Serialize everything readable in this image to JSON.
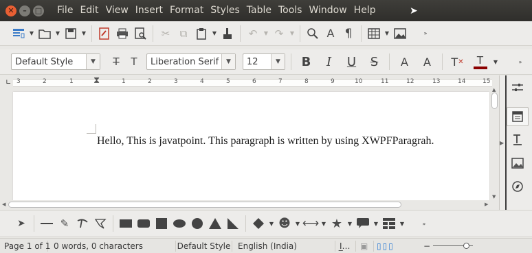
{
  "menubar": {
    "window_buttons": {
      "close": "✕",
      "minimize": "–",
      "maximize": "□"
    },
    "items": [
      "File",
      "Edit",
      "View",
      "Insert",
      "Format",
      "Styles",
      "Table",
      "Tools",
      "Window",
      "Help"
    ]
  },
  "standard_toolbar": {
    "icons": [
      "new-document-icon",
      "open-icon",
      "save-icon",
      "export-pdf-icon",
      "print-icon",
      "print-preview-icon",
      "cut-icon",
      "copy-icon",
      "paste-icon",
      "clone-formatting-icon",
      "undo-icon",
      "redo-icon",
      "find-replace-icon",
      "spelling-icon",
      "formatting-marks-icon",
      "insert-table-icon",
      "insert-image-icon"
    ]
  },
  "formatting_toolbar": {
    "paragraph_style": "Default Style",
    "font_name": "Liberation Serif",
    "font_size": "12",
    "bold": "B",
    "italic": "I",
    "underline": "U",
    "strikethrough": "S",
    "superscript": "A",
    "subscript": "A",
    "font_color": "#8b0000"
  },
  "ruler": {
    "left_numbers": [
      "3",
      "2",
      "1"
    ],
    "right_numbers": [
      "1",
      "2",
      "3",
      "4",
      "5",
      "6",
      "7",
      "8",
      "9",
      "10",
      "11",
      "12",
      "13",
      "14",
      "15"
    ]
  },
  "document": {
    "text": "Hello, This is javatpoint. This paragraph is written by using XWPFParagrah."
  },
  "sidebar": {
    "icons": [
      "properties-icon",
      "page-icon",
      "styles-icon",
      "gallery-icon",
      "navigator-icon"
    ]
  },
  "drawing_toolbar": {
    "icons": [
      "select-arrow-icon",
      "line-icon",
      "freeform-icon",
      "curve-icon",
      "polygon-icon",
      "rectangle-icon",
      "rounded-rectangle-icon",
      "square-icon",
      "ellipse-icon",
      "circle-icon",
      "triangle-icon",
      "right-triangle-icon",
      "diamond-icon",
      "smiley-icon",
      "double-arrow-icon",
      "star-icon",
      "callout-icon",
      "flowchart-icon"
    ]
  },
  "statusbar": {
    "page": "Page 1 of 1",
    "words": "0 words, 0 characters",
    "style": "Default Style",
    "language": "English (India)"
  }
}
